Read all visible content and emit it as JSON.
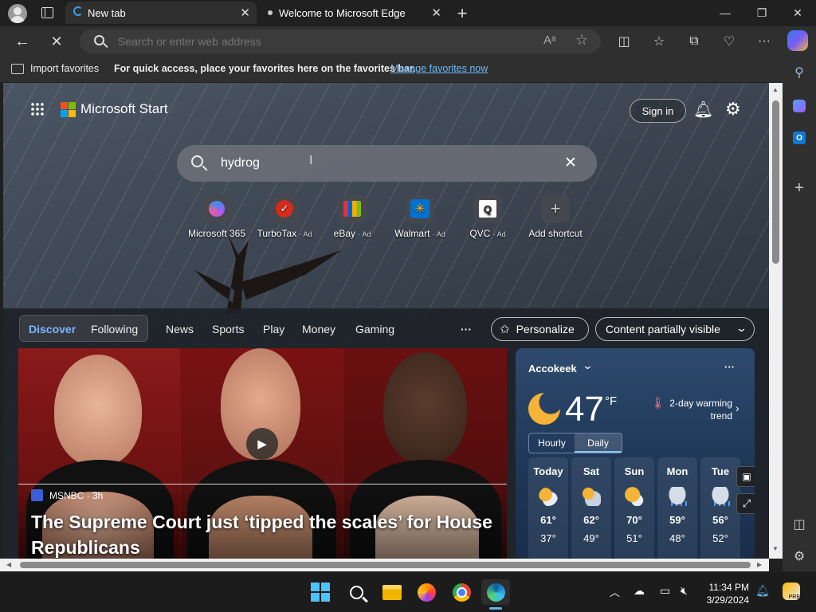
{
  "browser": {
    "tabs": [
      {
        "label": "New tab",
        "active": true
      },
      {
        "label": "Welcome to Microsoft Edge",
        "active": false
      }
    ],
    "address_placeholder": "Search or enter web address",
    "favorites_bar": {
      "import_label": "Import favorites",
      "message": "For quick access, place your favorites here on the favorites bar.",
      "manage_link": "Manage favorites now"
    }
  },
  "start": {
    "brand": "Microsoft Start",
    "sign_in": "Sign in",
    "search_value": "hydrog",
    "shortcuts": [
      {
        "label": "Microsoft 365",
        "ad": ""
      },
      {
        "label": "TurboTax",
        "ad": "· Ad"
      },
      {
        "label": "eBay",
        "ad": "· Ad"
      },
      {
        "label": "Walmart",
        "ad": "· Ad"
      },
      {
        "label": "QVC",
        "ad": "· Ad"
      },
      {
        "label": "Add shortcut",
        "ad": ""
      }
    ],
    "nav": {
      "discover": "Discover",
      "following": "Following",
      "links": [
        "News",
        "Sports",
        "Play",
        "Money",
        "Gaming"
      ],
      "more": "···",
      "personalize": "Personalize",
      "content_visibility": "Content partially visible"
    },
    "hero": {
      "source": "MSNBC · 3h",
      "headline": "The Supreme Court just ‘tipped the scales’ for House Republicans"
    },
    "weather": {
      "location": "Accokeek",
      "temperature": "47",
      "unit": "°F",
      "trend": "2-day warming trend",
      "tabs": [
        "Hourly",
        "Daily"
      ],
      "selected_tab": "Daily",
      "more": "···",
      "days": [
        {
          "name": "Today",
          "high": "61°",
          "low": "37°",
          "icon": "partly-sunny-icon"
        },
        {
          "name": "Sat",
          "high": "62°",
          "low": "49°",
          "icon": "partly-cloudy-icon"
        },
        {
          "name": "Sun",
          "high": "70°",
          "low": "51°",
          "icon": "partly-sunny-icon"
        },
        {
          "name": "Mon",
          "high": "59°",
          "low": "48°",
          "icon": "rain-icon"
        },
        {
          "name": "Tue",
          "high": "56°",
          "low": "52°",
          "icon": "rain-icon"
        }
      ]
    }
  },
  "taskbar": {
    "time": "11:34 PM",
    "date": "3/29/2024"
  },
  "colors": {
    "accent": "#6cb8f6",
    "browser_bg": "#202020",
    "toolbar_bg": "#2f2f2f",
    "taskbar_bg": "#1c1c1c"
  }
}
